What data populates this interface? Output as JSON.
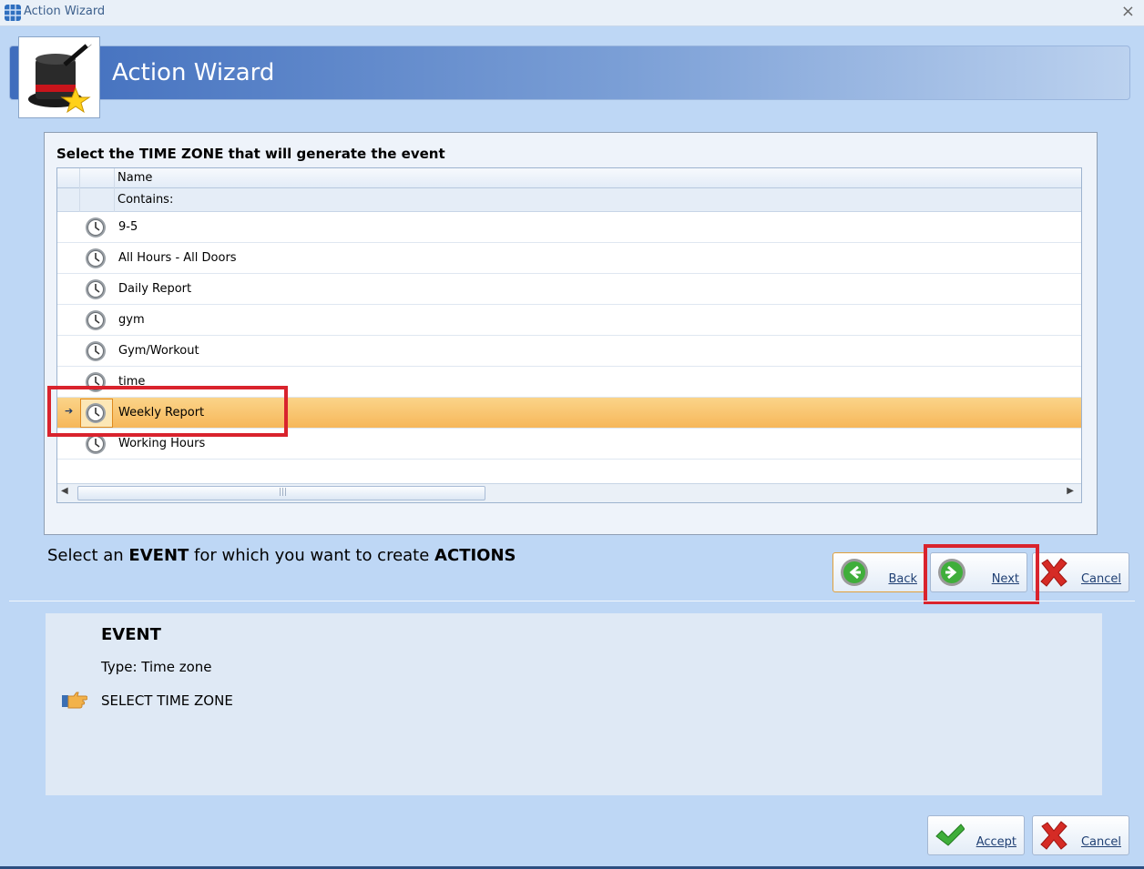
{
  "window": {
    "title": "Action Wizard",
    "close_glyph": "×"
  },
  "banner": {
    "title": "Action Wizard"
  },
  "grid": {
    "caption": "Select the TIME ZONE that will generate the event",
    "column_header": "Name",
    "filter_label": "Contains:",
    "rows": [
      {
        "name": "9-5"
      },
      {
        "name": "All Hours - All Doors"
      },
      {
        "name": "Daily Report"
      },
      {
        "name": "gym"
      },
      {
        "name": "Gym/Workout"
      },
      {
        "name": "time"
      },
      {
        "name": "Weekly Report",
        "selected": true
      },
      {
        "name": "Working Hours"
      }
    ],
    "selected_indicator": "➔"
  },
  "instruction": {
    "part1": "Select an ",
    "bold1": "EVENT",
    "part2": " for which you want to create ",
    "bold2": "ACTIONS"
  },
  "nav_buttons": {
    "back": "Back",
    "next": "Next",
    "cancel": "Cancel"
  },
  "event_panel": {
    "heading": "EVENT",
    "type_line": "Type: Time zone",
    "step": "SELECT TIME ZONE"
  },
  "footer_buttons": {
    "accept": "Accept",
    "cancel": "Cancel"
  },
  "colors": {
    "accent_blue": "#3f6dbd",
    "selection": "#f6b75a",
    "highlight_red": "#d9232d"
  }
}
